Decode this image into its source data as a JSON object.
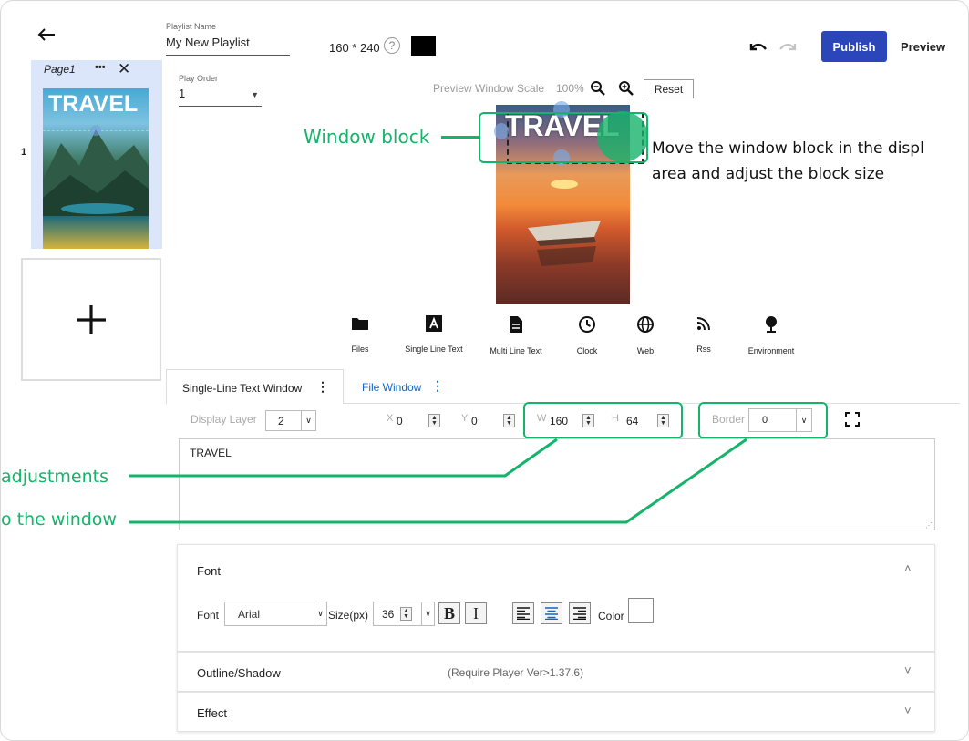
{
  "header": {
    "playlist_name_label": "Playlist Name",
    "playlist_name_value": "My New Playlist",
    "resolution": "160 * 240",
    "help_glyph": "?",
    "publish_label": "Publish",
    "preview_label": "Preview"
  },
  "pages": {
    "page_label": "Page1",
    "page_number": "1",
    "more_glyph": "•••",
    "close_glyph": "✕",
    "thumb_text": "TRAVEL",
    "add_glyph": "+"
  },
  "play_order": {
    "label": "Play Order",
    "value": "1"
  },
  "preview": {
    "scale_label": "Preview Window Scale",
    "scale_value": "100%",
    "reset_label": "Reset",
    "canvas_text": "TRAVEL"
  },
  "toolbar": {
    "tools": [
      {
        "label": "Files",
        "icon": "folder-icon"
      },
      {
        "label": "Single Line Text",
        "icon": "text-a-icon"
      },
      {
        "label": "Multi Line Text",
        "icon": "document-icon"
      },
      {
        "label": "Clock",
        "icon": "clock-icon"
      },
      {
        "label": "Web",
        "icon": "globe-icon"
      },
      {
        "label": "Rss",
        "icon": "rss-icon"
      },
      {
        "label": "Environment",
        "icon": "pin-icon"
      }
    ]
  },
  "tabs": [
    {
      "label": "Single-Line Text Window",
      "active": true
    },
    {
      "label": "File Window",
      "active": false
    }
  ],
  "props": {
    "display_layer_label": "Display Layer",
    "display_layer_value": "2",
    "x_label": "X",
    "x_value": "0",
    "y_label": "Y",
    "y_value": "0",
    "w_label": "W",
    "w_value": "160",
    "h_label": "H",
    "h_value": "64",
    "border_label": "Border",
    "border_value": "0"
  },
  "text_content": "TRAVEL",
  "font_panel": {
    "title": "Font",
    "font_label": "Font",
    "font_value": "Arial",
    "size_label": "Size(px)",
    "size_value": "36",
    "bold_glyph": "B",
    "italic_glyph": "I",
    "color_label": "Color"
  },
  "outline_panel": {
    "title": "Outline/Shadow",
    "note": "(Require Player Ver>1.37.6)"
  },
  "effect_panel": {
    "title": "Effect"
  },
  "annotations": {
    "window_block": "Window block",
    "move_line1": "Move the window block in the displ",
    "move_line2": "area and adjust the block size",
    "adjustments": "adjustments",
    "window": "o the window"
  },
  "colors": {
    "accent_green": "#16b36a",
    "publish_blue": "#2b46b8",
    "tab_blue": "#1565c0",
    "swatch_black": "#000000"
  }
}
